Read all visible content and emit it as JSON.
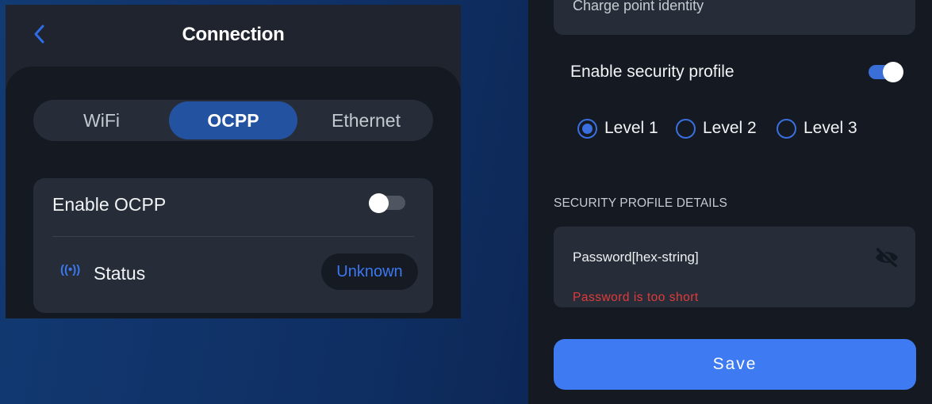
{
  "connection_screen": {
    "title": "Connection",
    "back_icon": "chevron-left-icon",
    "tabs": [
      {
        "label": "WiFi",
        "active": false
      },
      {
        "label": "OCPP",
        "active": true
      },
      {
        "label": "Ethernet",
        "active": false
      }
    ],
    "enable_ocpp": {
      "label": "Enable OCPP",
      "enabled": false
    },
    "status": {
      "icon": "((•))",
      "label": "Status",
      "value": "Unknown"
    }
  },
  "security_screen": {
    "charge_point_field_partial": "Charge point identity",
    "enable_security_profile": {
      "label": "Enable security profile",
      "enabled": true
    },
    "levels": [
      {
        "label": "Level 1",
        "selected": true
      },
      {
        "label": "Level 2",
        "selected": false
      },
      {
        "label": "Level 3",
        "selected": false
      }
    ],
    "section_heading": "SECURITY PROFILE DETAILS",
    "password": {
      "value": "Password[hex-string]",
      "visibility_icon": "eye-off-icon",
      "error": "Password is too short"
    },
    "save_label": "Save"
  },
  "colors": {
    "accent": "#3e7af1",
    "error": "#e23a3a",
    "card": "#262d38",
    "panel": "#141922",
    "background": "#0f2f63"
  }
}
